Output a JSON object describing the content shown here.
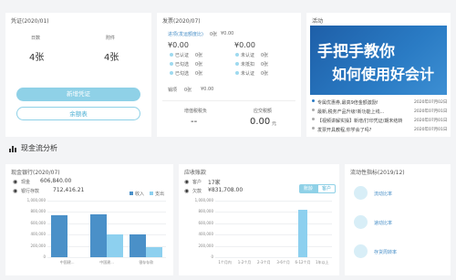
{
  "voucher": {
    "title": "凭证(2020/01)",
    "today_label": "日数",
    "attach_label": "附件",
    "today_value": "4张",
    "attach_value": "4张",
    "new_button": "新增凭证",
    "balance_button": "余额表"
  },
  "invoice": {
    "title": "发票(2020/07)",
    "row1_label": "进项(发运额度比)",
    "row1_zero": "0张",
    "row1_amount": "¥0.00",
    "sales_label": "销项",
    "sales_value": "0张",
    "sales_amount": "¥0.00",
    "items": [
      {
        "label": "已认证",
        "value": "0张"
      },
      {
        "label": "未认证",
        "value": "0张"
      },
      {
        "label": "已勾选",
        "value": "0张"
      },
      {
        "label": "未抵扣",
        "value": "0张"
      },
      {
        "label": "已勾选",
        "value": "0张"
      },
      {
        "label": "未认证",
        "value": "0张"
      }
    ],
    "amounts": [
      "¥0.00",
      "¥0.00",
      "¥0.00"
    ],
    "vat_label": "增值税税负",
    "vat_value": "--",
    "receivable_label": "应交税额",
    "receivable_value": "0.00",
    "receivable_unit": "元"
  },
  "activity": {
    "title": "活动",
    "banner_line1": "手把手教你",
    "banner_line2": "如何使用好会计",
    "news": [
      {
        "text": "专属优惠券,最高9倍金额激励!",
        "date": "2020年07月02日"
      },
      {
        "text": "最新,税务产品升级!新功能上线...",
        "date": "2020年07月01日"
      },
      {
        "text": "【视频讲解实操】新增/打印凭证/期末结转",
        "date": "2020年07月01日"
      },
      {
        "text": "发票开具教程,你学会了吗?",
        "date": "2020年07月01日"
      }
    ]
  },
  "cashflow": {
    "section_title": "现金流分析",
    "bank": {
      "title": "现金银行(2020/07)",
      "cash_label": "现金",
      "cash_value": "606,840.00",
      "deposit_label": "银行存款",
      "deposit_value": "712,416.21",
      "legend_in": "收入",
      "legend_out": "支出"
    },
    "receivable": {
      "title": "应收账款",
      "customer_label": "客户",
      "customer_value": "17家",
      "amount_label": "欠款",
      "amount_value": "¥831,708.00",
      "tab1": "账龄",
      "tab2": "客户"
    },
    "indicators": {
      "title": "流动性指标(2019/12)",
      "items": [
        "流动比率",
        "速动比率",
        "存货周转率"
      ]
    }
  },
  "chart_data": [
    {
      "type": "bar",
      "title": "",
      "categories": [
        "中国建...",
        "中国建...",
        "银存存款"
      ],
      "ylim": [
        0,
        1000000
      ],
      "yticks": [
        "1,000,000",
        "800,000",
        "600,000",
        "400,000",
        "200,000",
        "0"
      ],
      "series": [
        {
          "name": "收入",
          "values": [
            750000,
            760000,
            400000
          ]
        },
        {
          "name": "支出",
          "values": [
            0,
            400000,
            180000
          ]
        }
      ],
      "colors": [
        "#4a90c8",
        "#8dd0ef"
      ]
    },
    {
      "type": "bar",
      "title": "",
      "categories": [
        "1个月内",
        "1-2个月",
        "2-3个月",
        "3-6个月",
        "6-12个月",
        "1年以上"
      ],
      "ylim": [
        0,
        1000000
      ],
      "yticks": [
        "1,000,000",
        "800,000",
        "600,000",
        "400,000",
        "200,000",
        "0"
      ],
      "values": [
        0,
        0,
        0,
        0,
        831708,
        0
      ],
      "colors": [
        "#8dd0ef"
      ]
    }
  ]
}
